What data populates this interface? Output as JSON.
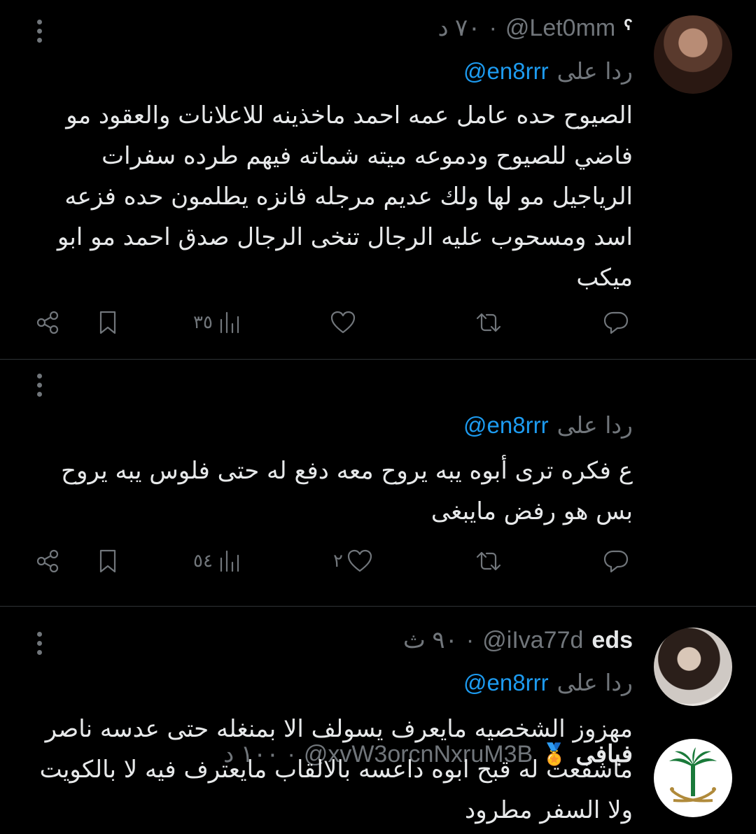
{
  "tweets": [
    {
      "display_name": "ˁ",
      "handle": "@Let0mm",
      "dot": "·",
      "time": "٧٠ د",
      "reply_label": "ردا على",
      "reply_to": "@en8rrr",
      "text": "الصيوح حده عامل عمه احمد ماخذينه للاعلانات والعقود مو فاضي للصيوح ودموعه ميته شماته فيهم طرده سفرات الرياجيل مو لها ولك عديم مرجله فانزه يطلمون حده فزعه اسد ومسحوب عليه الرجال تنخى الرجال صدق احمد مو ابو ميكب",
      "views": "٣٥",
      "likes": "",
      "retweets": "",
      "replies": ""
    },
    {
      "display_name": "فيافى",
      "badge_icon": "medal-icon",
      "handle": "@xvW3orcnNxruM3B",
      "dot": "·",
      "time": "١٠٠ د",
      "reply_label": "ردا على",
      "reply_to": "@en8rrr",
      "text": "ع فكره ترى أبوه يبه يروح معه دفع له حتى فلوس يبه يروح بس هو رفض مايبغى",
      "views": "٥٤",
      "likes": "٢",
      "retweets": "",
      "replies": ""
    },
    {
      "display_name": "eds",
      "handle": "@iIva77d",
      "dot": "·",
      "time": "٩٠ ث",
      "reply_label": "ردا على",
      "reply_to": "@en8rrr",
      "text": "مهزوز الشخصيه مايعرف يسولف الا بمنغله حتى عدسه ناصر ماشفعت له قبح ابوه داعسه بالالقاب مايعترف فيه لا بالكويت ولا السفر مطرود"
    }
  ],
  "colors": {
    "background": "#000000",
    "text": "#e7e9ea",
    "muted": "#71767b",
    "link": "#1d9bf0",
    "divider": "#2f3336"
  }
}
